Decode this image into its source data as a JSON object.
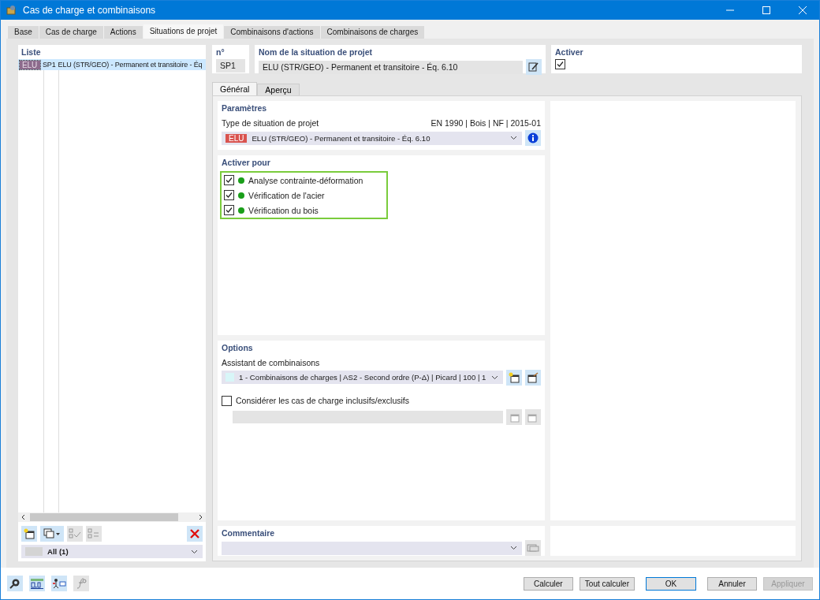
{
  "window": {
    "title": "Cas de charge et combinaisons"
  },
  "tabs": [
    {
      "label": "Base",
      "selected": false
    },
    {
      "label": "Cas de charge",
      "selected": false
    },
    {
      "label": "Actions",
      "selected": false
    },
    {
      "label": "Situations de projet",
      "selected": true
    },
    {
      "label": "Combinaisons d'actions",
      "selected": false
    },
    {
      "label": "Combinaisons de charges",
      "selected": false
    }
  ],
  "list": {
    "title": "Liste",
    "items": [
      {
        "badge": "ELU",
        "color": "#8c6b8c",
        "number": "SP1",
        "name": "ELU (STR/GEO) - Permanent et transitoire - Éq",
        "selected": true
      }
    ],
    "filter": "All (1)"
  },
  "number": {
    "label": "n°",
    "value": "SP1"
  },
  "name": {
    "label": "Nom de la situation de projet",
    "value": "ELU (STR/GEO) - Permanent et transitoire - Éq. 6.10"
  },
  "activate": {
    "label": "Activer",
    "checked": true
  },
  "subtabs": [
    {
      "label": "Général",
      "selected": true
    },
    {
      "label": "Aperçu",
      "selected": false
    }
  ],
  "parameters": {
    "title": "Paramètres",
    "type_label": "Type de situation de projet",
    "standard": "EN 1990 | Bois | NF | 2015-01",
    "type_badge": "ELU",
    "type_value": "ELU (STR/GEO) - Permanent et transitoire - Éq. 6.10"
  },
  "activate_for": {
    "title": "Activer pour",
    "items": [
      {
        "label": "Analyse contrainte-déformation",
        "checked": true,
        "color": "#1a9e1a"
      },
      {
        "label": "Vérification de l'acier",
        "checked": true,
        "color": "#1a9e1a"
      },
      {
        "label": "Vérification du bois",
        "checked": true,
        "color": "#1a9e1a"
      }
    ]
  },
  "options": {
    "title": "Options",
    "wizard_label": "Assistant de combinaisons",
    "wizard_value": "1 - Combinaisons de charges | AS2 - Second ordre (P-Δ) | Picard | 100 | 1",
    "inclusive_label": "Considérer les cas de charge inclusifs/exclusifs",
    "inclusive_checked": false
  },
  "comment": {
    "title": "Commentaire"
  },
  "buttons": [
    {
      "label": "Calculer",
      "default": false,
      "disabled": false
    },
    {
      "label": "Tout calculer",
      "default": false,
      "disabled": false
    },
    {
      "label": "OK",
      "default": true,
      "disabled": false
    },
    {
      "label": "Annuler",
      "default": false,
      "disabled": false
    },
    {
      "label": "Appliquer",
      "default": false,
      "disabled": true
    }
  ]
}
